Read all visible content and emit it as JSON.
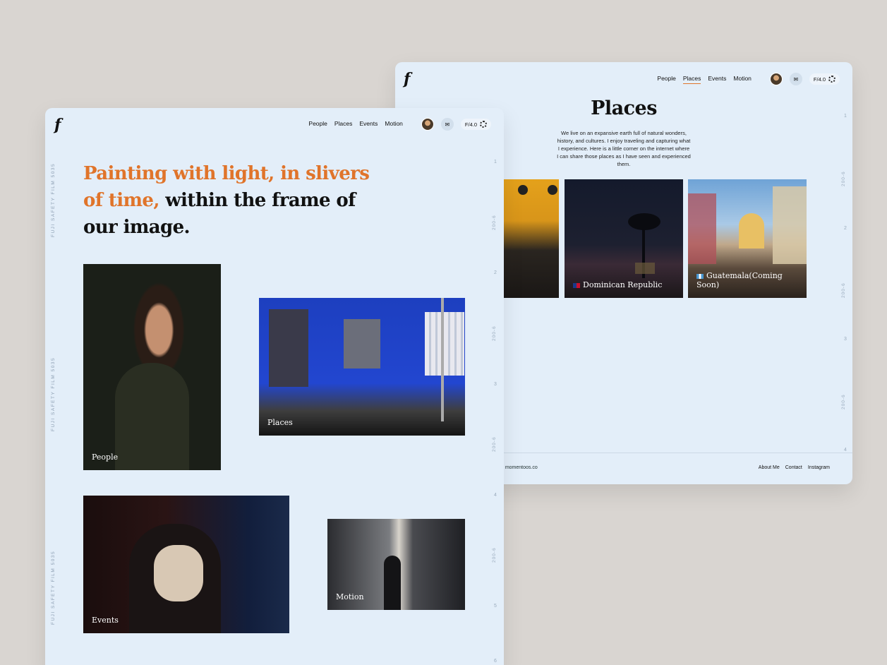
{
  "back": {
    "logo": "f",
    "nav": [
      "People",
      "Places",
      "Events",
      "Motion"
    ],
    "active_nav": "Places",
    "fstop": "F/4.0",
    "title": "Places",
    "description": "We live on an expansive earth full of natural wonders, history, and cultures. I enjoy traveling and capturing what I experience. Here is a little corner on the internet where I can share those places as I have seen and experienced them.",
    "cards": [
      {
        "label": ""
      },
      {
        "label": "Dominican Republic"
      },
      {
        "label": "Guatemala(Coming Soon)"
      }
    ],
    "footer": {
      "copyright": "d momentoos.co",
      "links": [
        "About Me",
        "Contact",
        "Instagram"
      ]
    },
    "ruler_nums": [
      "1",
      "2",
      "3",
      "4"
    ],
    "ruler_tag": "200-6"
  },
  "front": {
    "logo": "f",
    "nav": [
      "People",
      "Places",
      "Events",
      "Motion"
    ],
    "fstop": "F/4.0",
    "hero_accent": "Painting with light, in slivers of time,",
    "hero_rest": " within the frame of our image.",
    "cards": [
      {
        "label": "People"
      },
      {
        "label": "Places"
      },
      {
        "label": "Events"
      },
      {
        "label": "Motion"
      }
    ],
    "film_label": "FUJI  SAFETY  FILM  5035",
    "ruler_nums": [
      "1",
      "2",
      "3",
      "4",
      "5",
      "6"
    ],
    "ruler_tag": "200-6"
  },
  "colors": {
    "accent": "#e0742a",
    "card_bg": "#e3eef9",
    "page_bg": "#d9d5d1"
  }
}
